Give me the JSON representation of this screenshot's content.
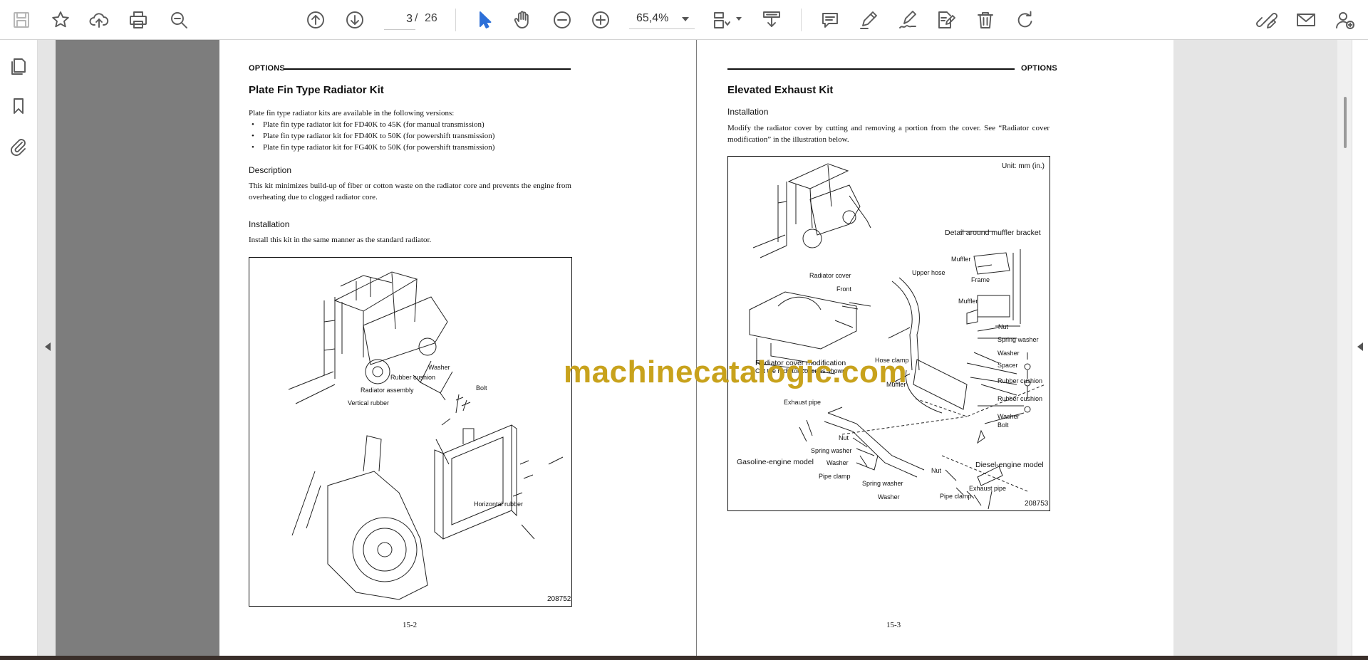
{
  "toolbar": {
    "page_current": "3",
    "page_separator": "/",
    "page_total": "26",
    "zoom": "65,4%"
  },
  "sidebar": {
    "icons": [
      "pages-icon",
      "bookmark-icon",
      "attachment-icon"
    ]
  },
  "left_page": {
    "header": "OPTIONS",
    "title": "Plate Fin Type Radiator Kit",
    "intro": "Plate fin type radiator kits are available in the following versions:",
    "bullets": [
      "Plate fin type radiator kit for FD40K to 45K (for manual transmission)",
      "Plate fin type radiator kit for FD40K to 50K (for powershift transmission)",
      "Plate fin type radiator kit for FG40K to 50K (for powershift transmission)"
    ],
    "description_heading": "Description",
    "description": "This kit minimizes build-up of fiber or cotton waste on the radiator core and prevents the engine from overheating due to clogged radiator core.",
    "installation_heading": "Installation",
    "installation": "Install this kit in the same manner as the standard radiator.",
    "figure": {
      "labels": {
        "washer": "Washer",
        "rubber_cushion": "Rubber cushion",
        "bolt": "Bolt",
        "radiator_assembly": "Radiator assembly",
        "vertical_rubber": "Vertical rubber",
        "horizontal_rubber": "Horizontal rubber"
      },
      "id": "208752"
    },
    "folio": "15-2"
  },
  "right_page": {
    "header": "OPTIONS",
    "title": "Elevated Exhaust Kit",
    "installation_heading": "Installation",
    "installation": "Modify the radiator cover by cutting and removing a portion from the cover.  See “Radiator cover modification” in the illustration below.",
    "figure": {
      "unit": "Unit:  mm (in.)",
      "labels": {
        "detail_muffler_bracket": "Detail around muffler bracket",
        "muffler_1": "Muffler",
        "frame": "Frame",
        "muffler_2": "Muffler",
        "radiator_cover": "Radiator cover",
        "front": "Front",
        "upper_hose": "Upper hose",
        "nut_1": "Nut",
        "spring_washer_1": "Spring washer",
        "washer_1": "Washer",
        "spacer": "Spacer",
        "rubber_cushion_1": "Rubber cushion",
        "rubber_cushion_2": "Rubber cushion",
        "washer_2": "Washer",
        "bolt": "Bolt",
        "radiator_cover_modification": "Radiator cover modification",
        "cut_note": "Cut the radiator cover as shown.",
        "hose_clamp": "Hose clamp",
        "muffler_3": "Muffler",
        "exhaust_pipe_1": "Exhaust pipe",
        "nut_2": "Nut",
        "spring_washer_2": "Spring washer",
        "washer_3": "Washer",
        "pipe_clamp_1": "Pipe clamp",
        "gasoline_model": "Gasoline-engine model",
        "diesel_model": "Diesel-engine model",
        "nut_3": "Nut",
        "spring_washer_3": "Spring washer",
        "washer_4": "Washer",
        "exhaust_pipe_2": "Exhaust pipe",
        "pipe_clamp_2": "Pipe clamp"
      },
      "id": "208753"
    },
    "folio": "15-3"
  },
  "watermark": "machinecatalogic.com",
  "colors": {
    "accent": "#2c6fd8",
    "watermark": "#c8a21c",
    "spread_background": "#7d7d7d"
  }
}
